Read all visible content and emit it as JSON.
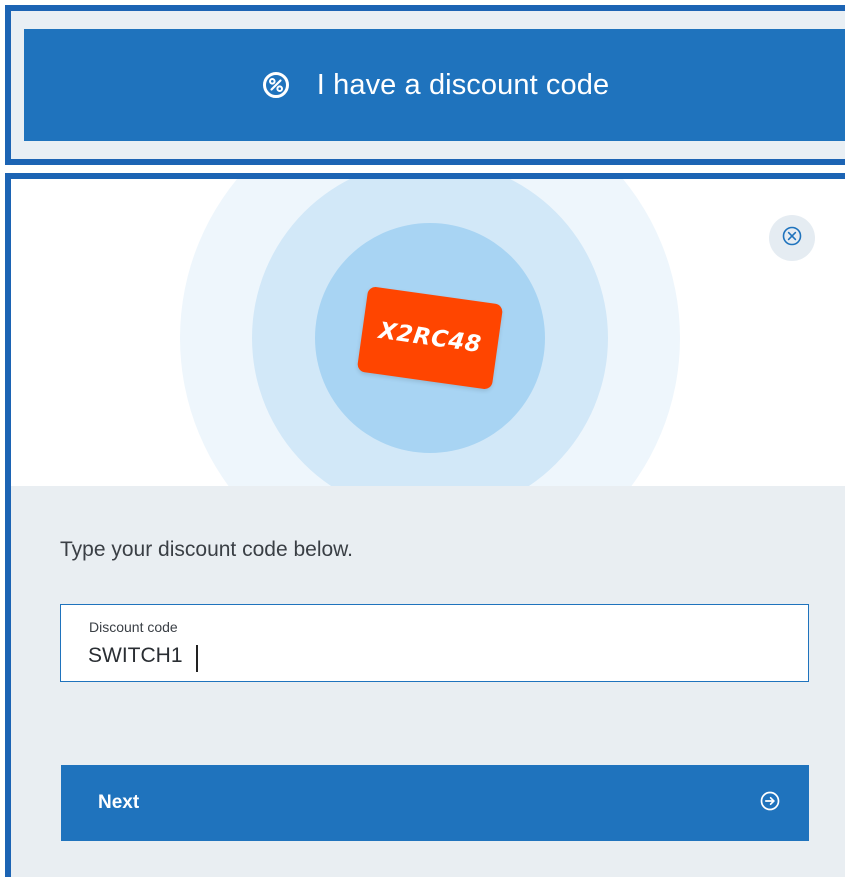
{
  "discount_toggle": {
    "label": "I have a discount code",
    "icon": "percent-badge-icon"
  },
  "hero": {
    "sample_code": "X2RC48",
    "close_icon": "close-circle-icon"
  },
  "form": {
    "instruction": "Type your discount code below.",
    "field_label": "Discount code",
    "field_value": "SWITCH1"
  },
  "next_button": {
    "label": "Next",
    "icon": "arrow-right-circle-icon"
  },
  "colors": {
    "primary": "#1f73bd",
    "frame": "#1c64b4",
    "card": "#ff4500",
    "form_bg": "#e9eef2"
  }
}
